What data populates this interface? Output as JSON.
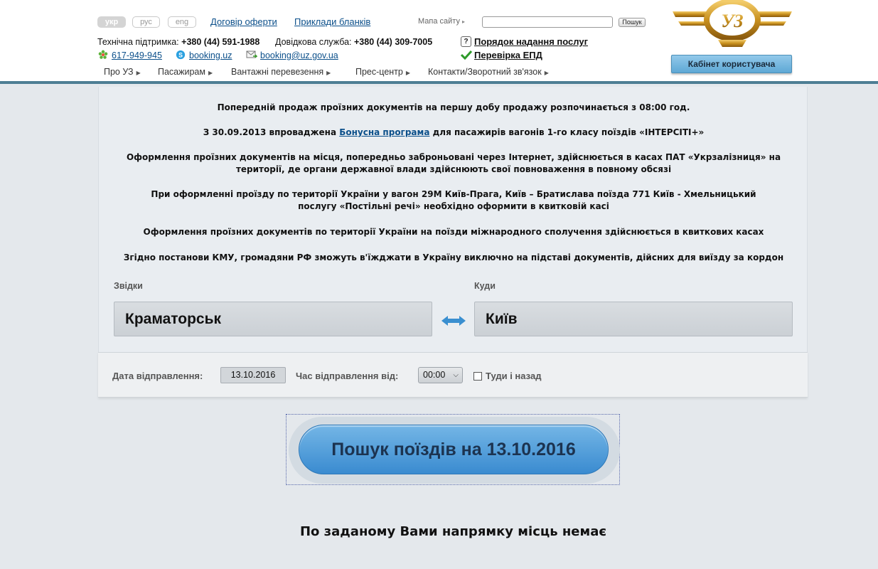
{
  "header": {
    "languages": [
      "укр",
      "рус",
      "eng"
    ],
    "active_language": "укр",
    "offer_link": "Договір оферти",
    "samples_link": "Приклади бланків",
    "sitemap_label": "Мапа сайту",
    "search_placeholder": "",
    "search_button": "Пошук",
    "tech_support_label": "Технічна підтримка:",
    "tech_support_phone": "+380 (44) 591-1988",
    "info_service_label": "Довідкова служба:",
    "info_service_phone": "+380 (44) 309-7005",
    "icq": "617-949-945",
    "skype": "booking.uz",
    "email": "booking@uz.gov.ua",
    "services_order_link": "Порядок надання послуг",
    "epd_check_link": "Перевірка ЕПД",
    "cabinet_button": "Кабінет користувача",
    "nav": [
      "Про УЗ",
      "Пасажирам",
      "Вантажні перевезення",
      "Прес-центр",
      "Контакти/Зворотний зв'язок"
    ]
  },
  "notices": {
    "n1": "Попередній продаж проїзних документів на першу добу продажу розпочинається з 08:00 год.",
    "n2_before": "З 30.09.2013 впроваджена ",
    "n2_link": "Бонусна програма",
    "n2_after": " для пасажирів вагонів 1-го класу поїздів «ІНТЕРСІТІ+»",
    "n3_line1": "Оформлення проїзних документів на місця, попередньо заброньовані через Інтернет, здійснюється в касах ПАТ «Укрзалізниця» на",
    "n3_line2": "території, де органи державної влади здійснюють свої повноваження в повному обсязі",
    "n4_line1": "При оформленні проїзду по території України у вагон 29М Київ-Прага, Київ – Братислава поїзда 771 Київ - Хмельницький",
    "n4_line2": "послугу «Постільні речі» необхідно оформити в квитковій касі",
    "n5": "Оформлення проїзних документів по території України на поїзди міжнародного сполучення здійснюється в квиткових касах",
    "n6": "Згідно постанови КМУ, громадяни РФ зможуть в'їжджати в Україну виключно на підставі документів, дійсних для виїзду за кордон"
  },
  "search_form": {
    "from_label": "Звідки",
    "from_value": "Краматорськ",
    "to_label": "Куди",
    "to_value": "Київ",
    "date_label": "Дата відправлення:",
    "date_value": "13.10.2016",
    "time_label": "Час відправлення від:",
    "time_value": "00:00",
    "roundtrip_label": "Туди і назад",
    "roundtrip_checked": false,
    "search_button": "Пошук поїздів на 13.10.2016"
  },
  "result_message": "По заданому Вами напрямку місць немає",
  "colors": {
    "header_border": "#4d7e94",
    "button_blue": "#3a8bd0",
    "link": "#0b4f8a",
    "logo_gold": "#c8901e"
  },
  "icons": [
    "icq-flower-icon",
    "skype-icon",
    "email-icon",
    "help-icon",
    "checkmark-icon",
    "swap-arrows-icon",
    "chevron-down-icon",
    "uz-logo"
  ]
}
